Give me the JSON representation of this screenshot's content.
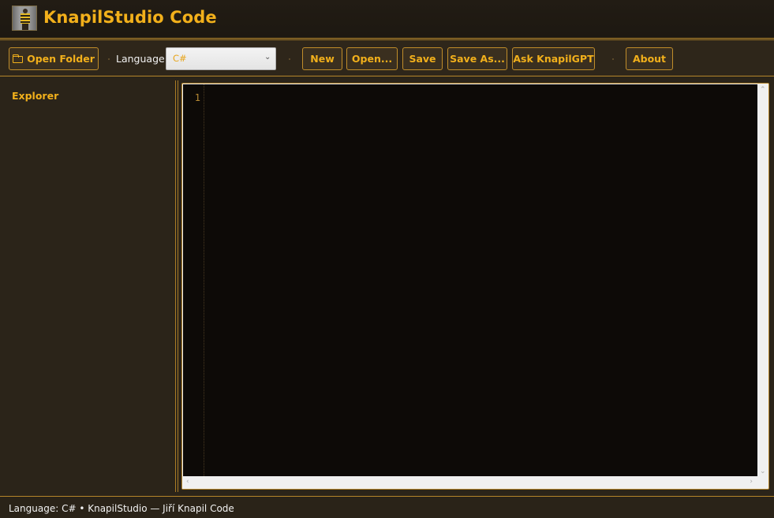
{
  "app": {
    "title": "KnapilStudio Code"
  },
  "toolbar": {
    "open_folder_label": "Open Folder",
    "language_label": "Language:",
    "language_selected": "C#",
    "new_label": "New",
    "open_label": "Open...",
    "save_label": "Save",
    "save_as_label": "Save As...",
    "ask_label": "Ask KnapilGPT",
    "about_label": "About"
  },
  "sidebar": {
    "title": "Explorer"
  },
  "editor": {
    "line_numbers": [
      "1"
    ]
  },
  "status": {
    "text": "Language: C# • KnapilStudio — Jiří Knapil Code"
  },
  "colors": {
    "accent": "#f2b01b",
    "border": "#b5852a",
    "background": "#2b2419",
    "editor_background": "#0d0a07"
  },
  "icons": {
    "folder": "folder-icon",
    "chevron": "chevron-down-icon"
  }
}
